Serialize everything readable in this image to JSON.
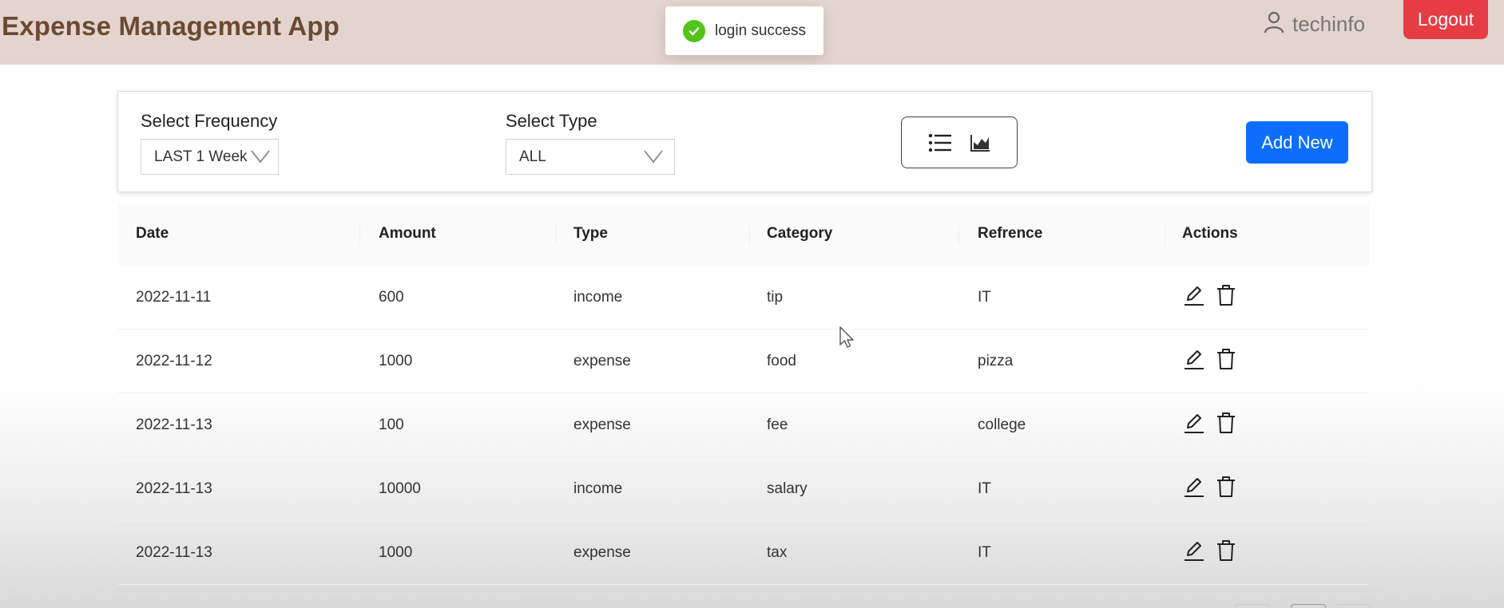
{
  "app": {
    "title": "Expense Management App"
  },
  "header": {
    "username": "techinfo",
    "logout_label": "Logout"
  },
  "toast": {
    "message": "login success"
  },
  "filters": {
    "frequency_label": "Select Frequency",
    "frequency_value": "LAST 1 Week",
    "type_label": "Select Type",
    "type_value": "ALL",
    "add_new_label": "Add New"
  },
  "table": {
    "columns": [
      "Date",
      "Amount",
      "Type",
      "Category",
      "Refrence",
      "Actions"
    ],
    "rows": [
      {
        "date": "2022-11-11",
        "amount": "600",
        "type": "income",
        "category": "tip",
        "reference": "IT"
      },
      {
        "date": "2022-11-12",
        "amount": "1000",
        "type": "expense",
        "category": "food",
        "reference": "pizza"
      },
      {
        "date": "2022-11-13",
        "amount": "100",
        "type": "expense",
        "category": "fee",
        "reference": "college"
      },
      {
        "date": "2022-11-13",
        "amount": "10000",
        "type": "income",
        "category": "salary",
        "reference": "IT"
      },
      {
        "date": "2022-11-13",
        "amount": "1000",
        "type": "expense",
        "category": "tax",
        "reference": "IT"
      }
    ]
  },
  "icons": {
    "user": "user-icon",
    "toast": "check-circle-icon",
    "list": "list-icon",
    "chart": "area-chart-icon",
    "edit": "edit-icon",
    "delete": "delete-icon"
  },
  "colors": {
    "header_bg": "#e3d4cf",
    "title": "#6b4a32",
    "logout": "#e63c44",
    "primary": "#0d6efd",
    "success": "#52c41a"
  }
}
